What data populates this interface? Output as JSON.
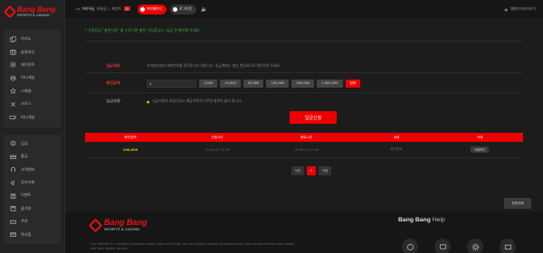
{
  "brand": {
    "name": "Bang Bang",
    "tagline": "SPORTS & CASINO"
  },
  "sidebar": {
    "group1": [
      {
        "label": "카지노",
        "icon": "cards-icon"
      },
      {
        "label": "슬롯머신",
        "icon": "slot-icon"
      },
      {
        "label": "에이전트",
        "icon": "agent-icon"
      },
      {
        "label": "미니게임",
        "icon": "ball-icon"
      },
      {
        "label": "스페셜",
        "icon": "star-icon"
      },
      {
        "label": "크로스",
        "icon": "cross-icon"
      },
      {
        "label": "미니게임",
        "icon": "gamepad-icon"
      }
    ],
    "group2": [
      {
        "label": "입금",
        "icon": "deposit-icon"
      },
      {
        "label": "출금",
        "icon": "withdraw-icon"
      },
      {
        "label": "고객센터",
        "icon": "support-icon"
      },
      {
        "label": "공지사항",
        "icon": "notice-icon"
      },
      {
        "label": "이벤트",
        "icon": "event-icon"
      },
      {
        "label": "출석부",
        "icon": "calendar-icon"
      },
      {
        "label": "쿠폰",
        "icon": "coupon-icon"
      },
      {
        "label": "쪽지함",
        "icon": "mail-icon"
      }
    ]
  },
  "topbar": {
    "user_prefix": "Lv.",
    "user_name": "하하하님",
    "balance_label": "보유금",
    "balance": "0",
    "point_label": "포인트",
    "point": "0",
    "deposit_button": "마이페이지",
    "logout_button": "로그아웃",
    "right_text": "웹페이지에서보기"
  },
  "main": {
    "notice": "* 수동입금 \"충전신청\" 을 누르시면 충전 가능합니다. 입금 전 확인해 주세요.",
    "account_label": "입금계좌",
    "account_text": "고객센터에서 계좌번호를 알려주시기 바랍니다. 입금계좌는 항상 변동되므로 확인하여 주세요.",
    "amount_label": "충전금액",
    "amount_value": "0",
    "chips": [
      "1,000",
      "10,000",
      "50,000",
      "100,000",
      "500,000",
      "1,000,000"
    ],
    "reset": "정정",
    "caution_label": "입금자명",
    "caution_text": "입금자명과 회원가입시 예금주명이 다르면 충전이 불가 합니다.",
    "submit": "입금신청",
    "table": {
      "headers": [
        "충전금액",
        "신청시간",
        "완료시간",
        "상태",
        "삭제"
      ],
      "rows": [
        {
          "amount": "100,000",
          "requested": "19-09-01 22:58",
          "completed": "19-09-01 23:04",
          "status": "충전완료",
          "delete": "삭제하기"
        }
      ]
    },
    "pager": {
      "prev": "이전",
      "current": "1",
      "next": "다음"
    },
    "delete_all": "전체삭제"
  },
  "footer": {
    "text": "Our website is a company operated under a formal license. You can enjoy a variety of games online, and we provide the best quality and best mobile version.",
    "help_title_bold": "Bang Bang",
    "help_title_rest": " Help",
    "help_icons": [
      "faq-icon",
      "chat-icon",
      "settings-icon",
      "message-icon"
    ]
  }
}
